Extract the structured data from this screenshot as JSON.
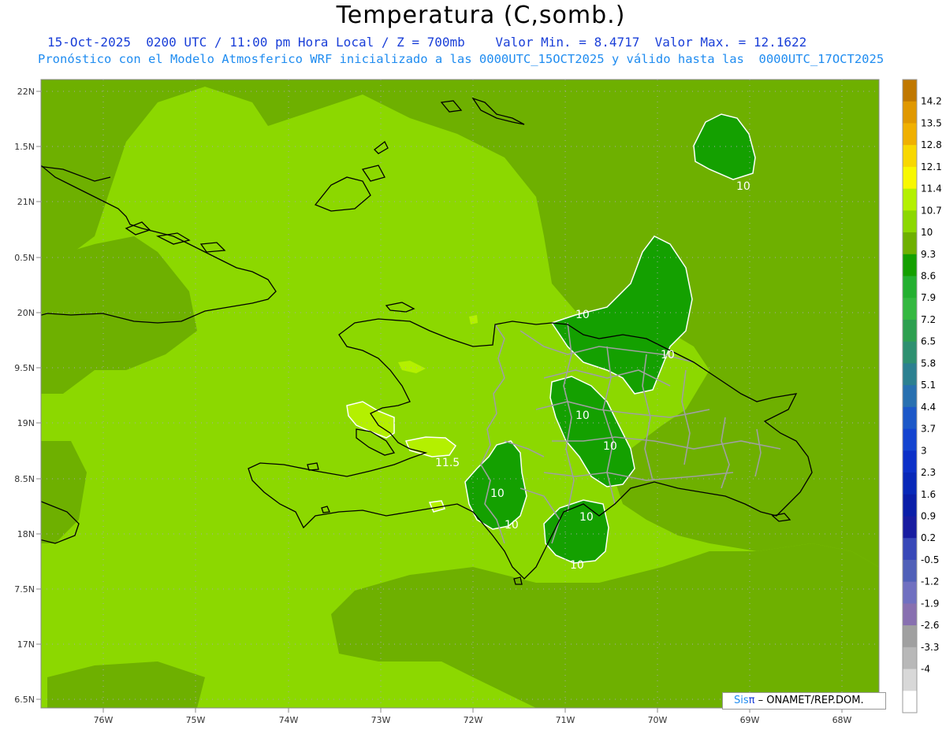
{
  "header": {
    "title": "Temperatura (C,somb.)",
    "line1": "15-Oct-2025  0200 UTC / 11:00 pm Hora Local / Z = 700mb    Valor Min. = 8.4717  Valor Max. = 12.1622",
    "line2": "Pronóstico con el Modelo Atmosferico WRF inicializado a las 0000UTC_15OCT2025 y válido hasta las  0000UTC_17OCT2025"
  },
  "axes": {
    "lat_labels": [
      "22N",
      "1.5N",
      "21N",
      "0.5N",
      "20N",
      "9.5N",
      "19N",
      "8.5N",
      "18N",
      "7.5N",
      "17N",
      "6.5N"
    ],
    "lon_labels": [
      "76W",
      "75W",
      "74W",
      "73W",
      "72W",
      "71W",
      "70W",
      "69W",
      "68W"
    ]
  },
  "colorbar": {
    "labels": [
      "14.2",
      "13.5",
      "12.8",
      "12.1",
      "11.4",
      "10.7",
      "10",
      "9.3",
      "8.6",
      "7.9",
      "7.2",
      "6.5",
      "5.8",
      "5.1",
      "4.4",
      "3.7",
      "3",
      "2.3",
      "1.6",
      "0.9",
      "0.2",
      "-0.5",
      "-1.2",
      "-1.9",
      "-2.6",
      "-3.3",
      "-4"
    ],
    "colors": [
      "#c07800",
      "#e09800",
      "#f0b000",
      "#f8d800",
      "#f8f800",
      "#b4f000",
      "#8cd800",
      "#6eb000",
      "#14a000",
      "#24b030",
      "#34b840",
      "#2ea050",
      "#2e9070",
      "#2c8090",
      "#2870b0",
      "#1c58c8",
      "#1444d0",
      "#0c30c8",
      "#0828b8",
      "#0a1ea8",
      "#181ca0",
      "#3848b8",
      "#5060b8",
      "#7070c0",
      "#8870b0",
      "#a0a0a0",
      "#b8b8b8",
      "#d8d8d8",
      "#ffffff"
    ]
  },
  "map_colors": {
    "dark": "#6eb000",
    "mid": "#8cd800",
    "light": "#b4f000",
    "cold": "#14a000",
    "coast": "#000000",
    "border": "#a0a0a0"
  },
  "contour_labels": [
    "10",
    "10",
    "10",
    "10",
    "10",
    "10",
    "10",
    "10",
    "11.5"
  ],
  "credit": {
    "sis": "Sis",
    "pi": "π",
    "rest": " – ONAMET/REP.DOM."
  }
}
